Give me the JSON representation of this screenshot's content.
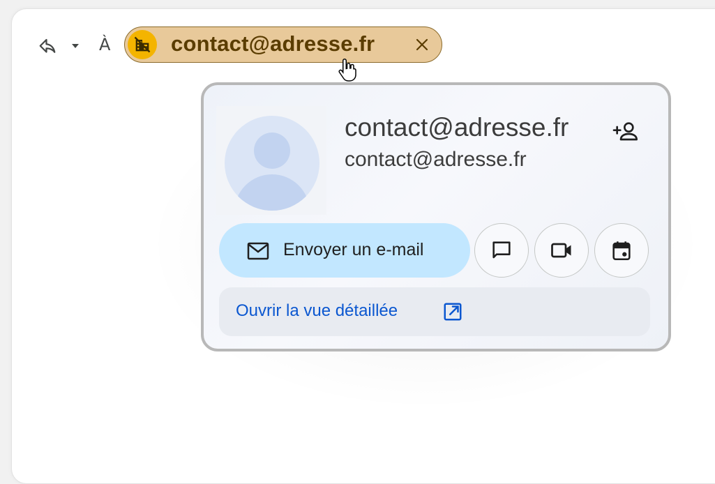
{
  "header": {
    "to_label": "À",
    "recipient_chip": {
      "text": "contact@adresse.fr",
      "avatar_icon": "domain-disabled-icon",
      "close_icon": "close-icon"
    }
  },
  "contact_card": {
    "name": "contact@adresse.fr",
    "email": "contact@adresse.fr",
    "avatar_icon": "default-avatar-icon",
    "add_contact_icon": "add-contact-icon",
    "actions": {
      "send_email_label": "Envoyer un e-mail",
      "send_email_icon": "mail-icon",
      "chat_icon": "chat-icon",
      "video_icon": "video-call-icon",
      "calendar_icon": "calendar-icon"
    },
    "detail_link": {
      "label": "Ouvrir la vue détaillée",
      "icon": "open-in-new-icon"
    }
  },
  "colors": {
    "chip_bg": "#e8c99a",
    "chip_avatar": "#f4b400",
    "send_button": "#c2e7ff",
    "link": "#0b57d0"
  }
}
